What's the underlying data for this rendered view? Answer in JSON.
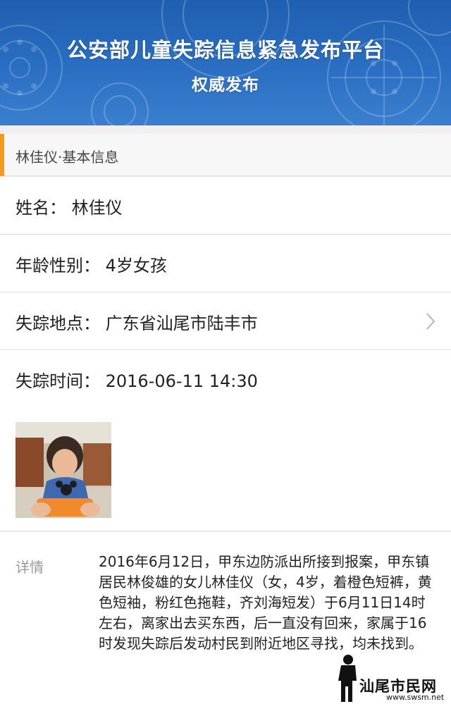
{
  "banner": {
    "title": "公安部儿童失踪信息紧急发布平台",
    "subtitle": "权威发布"
  },
  "section": {
    "title": "林佳仪·基本信息"
  },
  "fields": {
    "name": "姓名：  林佳仪",
    "age_gender": "年龄性别：  4岁女孩",
    "location": "失踪地点：  广东省汕尾市陆丰市",
    "time": "失踪时间：  2016-06-11 14:30"
  },
  "detail": {
    "label": "详情",
    "text": "2016年6月12日，甲东边防派出所接到报案，甲东镇居民林俊雄的女儿林佳仪（女，4岁，着橙色短裤，黄色短袖，粉红色拖鞋，齐刘海短发）于6月11日14时左右，离家出去买东西，后一直没有回来，家属于16时发现失踪后发动村民到附近地区寻找，均未找到。"
  },
  "watermark": {
    "text": "汕尾市民网",
    "url": "www.swsm.net"
  },
  "colors": {
    "banner": "#2a6fc3",
    "accent": "#f39a1e",
    "background": "#efeff4"
  },
  "icons": {
    "chevron": "chevron-right-icon"
  }
}
